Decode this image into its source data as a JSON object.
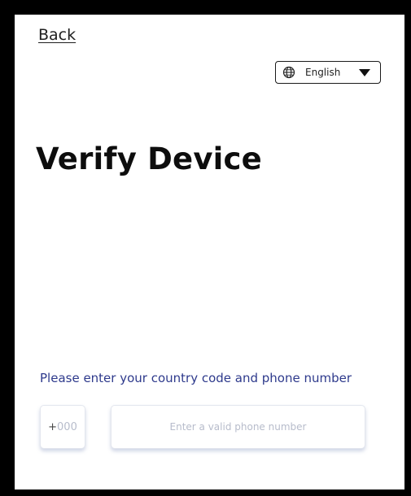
{
  "header": {
    "back_label": "Back"
  },
  "language": {
    "selected": "English",
    "icon": "globe-icon",
    "dropdown_icon": "caret-down-icon"
  },
  "main": {
    "title": "Verify Device",
    "instruction": "Please enter your country code and phone number"
  },
  "form": {
    "country_code_prefix": "+",
    "country_code_placeholder": "000",
    "phone_placeholder": "Enter a valid phone number"
  },
  "colors": {
    "frame_border": "#000000",
    "title": "#0d0d0d",
    "instruction": "#2e3a8c",
    "placeholder": "#b7bccb"
  }
}
